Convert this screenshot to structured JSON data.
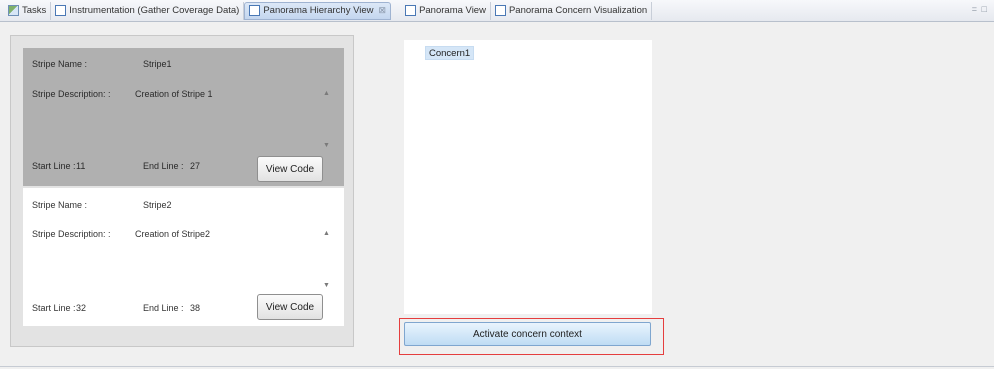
{
  "tabs": [
    {
      "label": "Tasks",
      "icon": "tasks-icon",
      "active": false
    },
    {
      "label": "Instrumentation (Gather Coverage Data)",
      "icon": "view-icon",
      "active": false
    },
    {
      "label": "Panorama Hierarchy View",
      "icon": "view-icon",
      "active": true,
      "close_glyph": "⊠"
    },
    {
      "label": "Panorama View",
      "icon": "view-icon",
      "active": false
    },
    {
      "label": "Panorama Concern Visualization",
      "icon": "view-icon",
      "active": false
    }
  ],
  "tab_controls": "= □",
  "stripes": [
    {
      "name_label": "Stripe Name :",
      "name": "Stripe1",
      "description_label": "Stripe Description: :",
      "description": "Creation of Stripe 1",
      "start_label": "Start Line :",
      "start_line": "11",
      "end_label": "End Line :",
      "end_line": "27",
      "button_label": "View Code",
      "selected": true
    },
    {
      "name_label": "Stripe Name :",
      "name": "Stripe2",
      "description_label": "Stripe Description: :",
      "description": "Creation of Stripe2",
      "start_label": "Start Line :",
      "start_line": "32",
      "end_label": "End Line :",
      "end_line": "38",
      "button_label": "View Code",
      "selected": false
    }
  ],
  "scroll_up_glyph": "▲",
  "scroll_down_glyph": "▼",
  "concerns": [
    "Concern1"
  ],
  "activate_button_label": "Activate concern context",
  "colors": {
    "selected_stripe": "#b0b0b0",
    "highlight_frame": "#e53e3e",
    "concern_highlight": "#d5e6f7"
  }
}
